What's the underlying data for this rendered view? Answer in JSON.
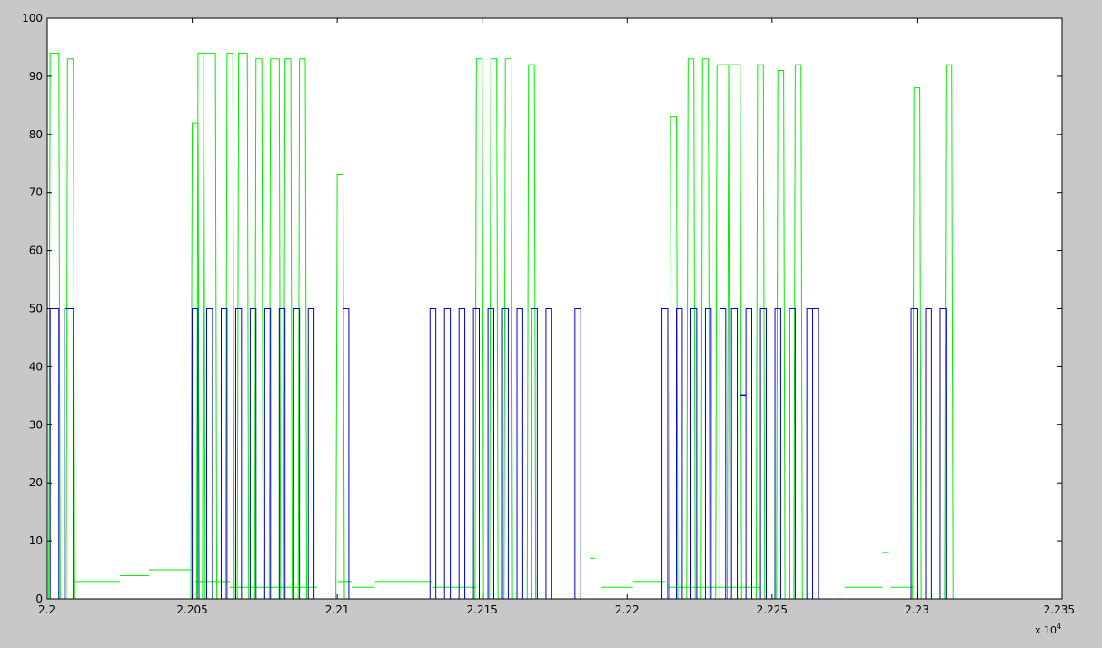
{
  "chart_data": {
    "type": "line",
    "title": "",
    "xlabel": "",
    "ylabel": "",
    "x_scale_label": {
      "base": "x 10",
      "exponent": "4"
    },
    "xlim": [
      2.2,
      2.235
    ],
    "ylim": [
      0,
      100
    ],
    "x_ticks": [
      2.2,
      2.205,
      2.21,
      2.215,
      2.22,
      2.225,
      2.23,
      2.235
    ],
    "x_tick_labels": [
      "2.2",
      "2.205",
      "2.21",
      "2.215",
      "2.22",
      "2.225",
      "2.23",
      "2.235"
    ],
    "y_ticks": [
      0,
      10,
      20,
      30,
      40,
      50,
      60,
      70,
      80,
      90,
      100
    ],
    "y_tick_labels": [
      "0",
      "10",
      "20",
      "30",
      "40",
      "50",
      "60",
      "70",
      "80",
      "90",
      "100"
    ],
    "grid": false,
    "legend": "none",
    "background": "#c8c8c8",
    "axes_background": "#ffffff",
    "series": [
      {
        "color": "#00ee00",
        "base_segments": [
          [
            2.2,
            2.2008,
            0
          ],
          [
            2.2009,
            2.2025,
            3
          ],
          [
            2.2025,
            2.2035,
            4
          ],
          [
            2.2035,
            2.205,
            5
          ],
          [
            2.2051,
            2.2063,
            3
          ],
          [
            2.2063,
            2.2093,
            2
          ],
          [
            2.2093,
            2.21,
            1
          ],
          [
            2.21,
            2.2105,
            3
          ],
          [
            2.2105,
            2.2113,
            2
          ],
          [
            2.2113,
            2.2133,
            3
          ],
          [
            2.2133,
            2.2148,
            2
          ],
          [
            2.2149,
            2.2163,
            1
          ],
          [
            2.2163,
            2.2172,
            1
          ],
          [
            2.2172,
            2.2179,
            0
          ],
          [
            2.2179,
            2.2186,
            1
          ],
          [
            2.2187,
            2.2189,
            7
          ],
          [
            2.2191,
            2.2202,
            2
          ],
          [
            2.2202,
            2.2213,
            3
          ],
          [
            2.2214,
            2.2221,
            2
          ],
          [
            2.2221,
            2.2246,
            2
          ],
          [
            2.2246,
            2.225,
            0
          ],
          [
            2.225,
            2.2258,
            0
          ],
          [
            2.2258,
            2.2265,
            1
          ],
          [
            2.2265,
            2.2272,
            0
          ],
          [
            2.2272,
            2.2275,
            1
          ],
          [
            2.2275,
            2.2288,
            2
          ],
          [
            2.2288,
            2.229,
            8
          ],
          [
            2.2291,
            2.2299,
            2
          ],
          [
            2.2299,
            2.2304,
            1
          ],
          [
            2.2304,
            2.231,
            1
          ],
          [
            2.2312,
            2.235,
            0
          ]
        ],
        "peaks": [
          {
            "x1": 2.2001,
            "x2": 2.2004,
            "y": 94
          },
          {
            "x1": 2.2007,
            "x2": 2.2009,
            "y": 93
          },
          {
            "x1": 2.205,
            "x2": 2.2052,
            "y": 82
          },
          {
            "x1": 2.2052,
            "x2": 2.2054,
            "y": 94
          },
          {
            "x1": 2.2054,
            "x2": 2.2058,
            "y": 94
          },
          {
            "x1": 2.2062,
            "x2": 2.2064,
            "y": 94
          },
          {
            "x1": 2.2066,
            "x2": 2.2069,
            "y": 94
          },
          {
            "x1": 2.2072,
            "x2": 2.2074,
            "y": 93
          },
          {
            "x1": 2.2077,
            "x2": 2.208,
            "y": 93
          },
          {
            "x1": 2.2082,
            "x2": 2.2084,
            "y": 93
          },
          {
            "x1": 2.2087,
            "x2": 2.2089,
            "y": 93
          },
          {
            "x1": 2.21,
            "x2": 2.2102,
            "y": 73
          },
          {
            "x1": 2.2148,
            "x2": 2.215,
            "y": 93
          },
          {
            "x1": 2.2153,
            "x2": 2.2155,
            "y": 93
          },
          {
            "x1": 2.2158,
            "x2": 2.216,
            "y": 93
          },
          {
            "x1": 2.2166,
            "x2": 2.2168,
            "y": 92
          },
          {
            "x1": 2.2215,
            "x2": 2.2217,
            "y": 83
          },
          {
            "x1": 2.2221,
            "x2": 2.2223,
            "y": 93
          },
          {
            "x1": 2.2226,
            "x2": 2.2228,
            "y": 93
          },
          {
            "x1": 2.2231,
            "x2": 2.2235,
            "y": 92
          },
          {
            "x1": 2.2235,
            "x2": 2.2239,
            "y": 92
          },
          {
            "x1": 2.2245,
            "x2": 2.2247,
            "y": 92
          },
          {
            "x1": 2.2252,
            "x2": 2.2254,
            "y": 91
          },
          {
            "x1": 2.2258,
            "x2": 2.226,
            "y": 92
          },
          {
            "x1": 2.2299,
            "x2": 2.2301,
            "y": 88
          },
          {
            "x1": 2.231,
            "x2": 2.2312,
            "y": 92
          }
        ]
      },
      {
        "color": "#0000cc",
        "pulse_height": 50,
        "dip_value": 35,
        "dip_range": [
          2.2239,
          2.2241
        ],
        "pulses": [
          [
            2.2001,
            2.2004
          ],
          [
            2.2006,
            2.2009
          ],
          [
            2.205,
            2.2052
          ],
          [
            2.2055,
            2.2057
          ],
          [
            2.206,
            2.2062
          ],
          [
            2.2065,
            2.2067
          ],
          [
            2.207,
            2.2072
          ],
          [
            2.2075,
            2.2077
          ],
          [
            2.208,
            2.2082
          ],
          [
            2.2085,
            2.2087
          ],
          [
            2.209,
            2.2092
          ],
          [
            2.2102,
            2.2104
          ],
          [
            2.2132,
            2.2134
          ],
          [
            2.2137,
            2.2139
          ],
          [
            2.2142,
            2.2144
          ],
          [
            2.2147,
            2.2149
          ],
          [
            2.2152,
            2.2154
          ],
          [
            2.2157,
            2.2159
          ],
          [
            2.2162,
            2.2164
          ],
          [
            2.2167,
            2.2169
          ],
          [
            2.2172,
            2.2174
          ],
          [
            2.2182,
            2.2184
          ],
          [
            2.2212,
            2.2214
          ],
          [
            2.2217,
            2.2219
          ],
          [
            2.2222,
            2.2224
          ],
          [
            2.2227,
            2.2229
          ],
          [
            2.2232,
            2.2234
          ],
          [
            2.2236,
            2.2238
          ],
          [
            2.2241,
            2.2243
          ],
          [
            2.2246,
            2.2248
          ],
          [
            2.2251,
            2.2253
          ],
          [
            2.2256,
            2.2258
          ],
          [
            2.2262,
            2.2264
          ],
          [
            2.2264,
            2.2266
          ],
          [
            2.2298,
            2.23
          ],
          [
            2.2303,
            2.2305
          ],
          [
            2.2308,
            2.231
          ]
        ]
      }
    ]
  }
}
